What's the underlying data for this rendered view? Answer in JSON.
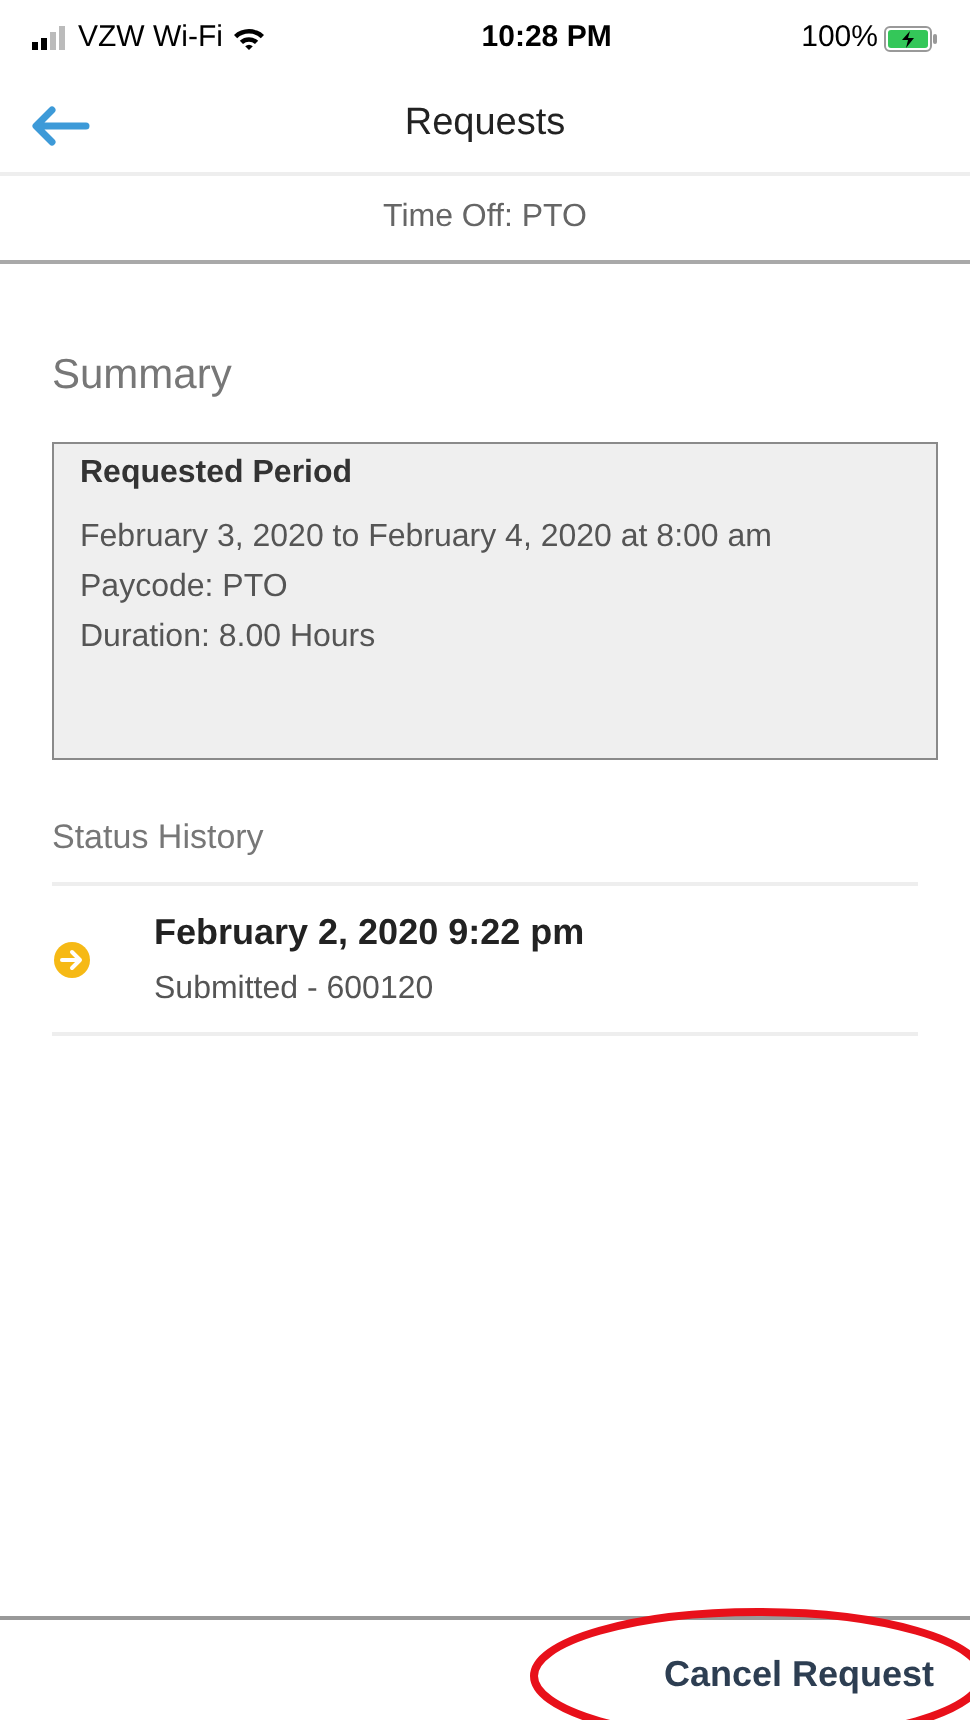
{
  "status_bar": {
    "carrier": "VZW Wi-Fi",
    "time": "10:28 PM",
    "battery": "100%"
  },
  "header": {
    "title": "Requests"
  },
  "subtitle": "Time Off: PTO",
  "summary": {
    "heading": "Summary",
    "card_title": "Requested Period",
    "lines": [
      "February 3, 2020 to February 4, 2020 at 8:00 am",
      "Paycode: PTO",
      "Duration: 8.00 Hours"
    ]
  },
  "status_history": {
    "heading": "Status History",
    "entries": [
      {
        "date": "February 2, 2020 9:22 pm",
        "detail": "Submitted - 600120",
        "kind": "submitted"
      }
    ]
  },
  "footer": {
    "button": "Cancel Request"
  }
}
